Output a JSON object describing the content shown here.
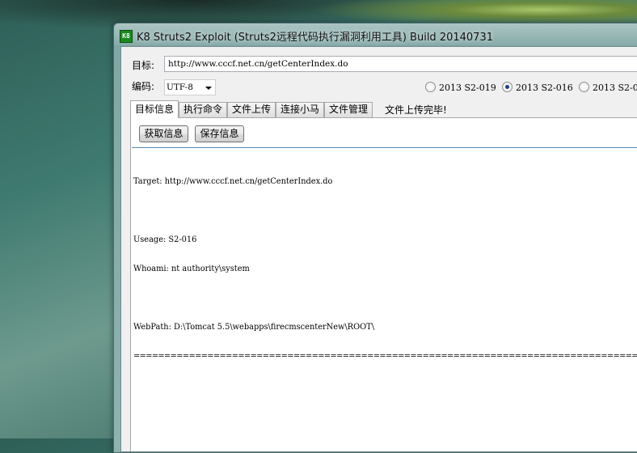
{
  "window": {
    "title": "K8 Struts2 Exploit (Struts2远程代码执行漏洞利用工具)  Build 20140731",
    "icon": "k8-app-icon",
    "icon_text": "K8"
  },
  "target": {
    "label": "目标:",
    "url": "http://www.cccf.net.cn/getCenterIndex.do"
  },
  "encoding": {
    "label": "编码:",
    "value": "UTF-8"
  },
  "exploits": [
    {
      "label": "2013 S2-019",
      "selected": false
    },
    {
      "label": "2013 S2-016",
      "selected": true
    },
    {
      "label": "2013 S2-0",
      "selected": false
    }
  ],
  "tabs": [
    {
      "label": "目标信息",
      "active": true
    },
    {
      "label": "执行命令",
      "active": false
    },
    {
      "label": "文件上传",
      "active": false
    },
    {
      "label": "连接小马",
      "active": false
    },
    {
      "label": "文件管理",
      "active": false
    }
  ],
  "status": "文件上传完毕!",
  "buttons": {
    "get_info": "获取信息",
    "save_info": "保存信息"
  },
  "output": {
    "lines": [
      "Target: http://www.cccf.net.cn/getCenterIndex.do",
      "",
      "Useage: S2-016",
      "Whoami: nt authority\\system",
      "",
      "WebPath: D:\\Tomcat 5.5\\webapps\\firecmscenterNew\\ROOT\\",
      "================================================================================================================================================"
    ]
  }
}
